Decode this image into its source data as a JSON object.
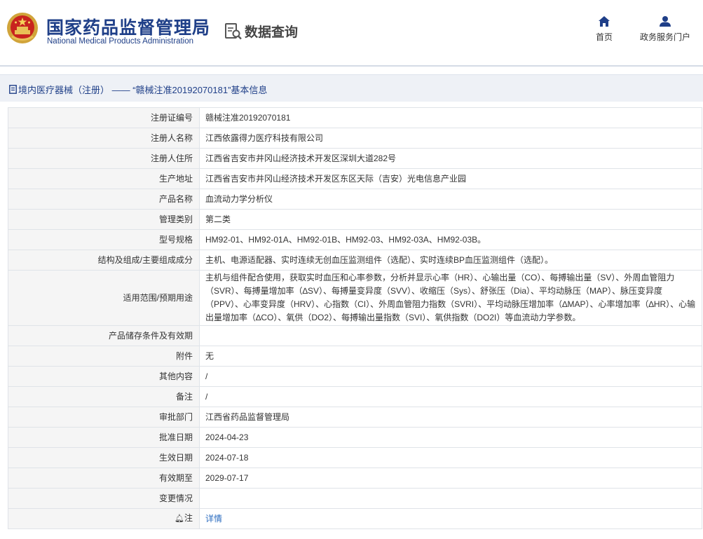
{
  "header": {
    "agency_name_cn": "国家药品监督管理局",
    "agency_name_en": "National Medical Products Administration",
    "module_title": "数据查询",
    "emblem_icon": "national-emblem-icon",
    "nav": [
      {
        "label": "首页",
        "icon": "home-icon"
      },
      {
        "label": "政务服务门户",
        "icon": "user-icon"
      }
    ]
  },
  "breadcrumb": {
    "icon": "document-icon",
    "text": "境内医疗器械（注册） —— “赣械注准20192070181”基本信息"
  },
  "fields": [
    {
      "label": "注册证编号",
      "value": "赣械注准20192070181"
    },
    {
      "label": "注册人名称",
      "value": "江西依露得力医疗科技有限公司"
    },
    {
      "label": "注册人住所",
      "value": "江西省吉安市井冈山经济技术开发区深圳大道282号"
    },
    {
      "label": "生产地址",
      "value": "江西省吉安市井冈山经济技术开发区东区天际（吉安）光电信息产业园"
    },
    {
      "label": "产品名称",
      "value": "血流动力学分析仪"
    },
    {
      "label": "管理类别",
      "value": "第二类"
    },
    {
      "label": "型号规格",
      "value": "HM92-01、HM92-01A、HM92-01B、HM92-03、HM92-03A、HM92-03B。"
    },
    {
      "label": "结构及组成/主要组成成分",
      "value": "主机、电源适配器、实时连续无创血压监测组件（选配）、实时连续BP血压监测组件（选配）。"
    },
    {
      "label": "适用范围/预期用途",
      "value": "主机与组件配合使用，获取实时血压和心率参数，分析并显示心率（HR）、心输出量（CO）、每搏输出量（SV）、外周血管阻力（SVR）、每搏量增加率（∆SV）、每搏量变异度（SVV）、收缩压（Sys）、舒张压（Dia）、平均动脉压（MAP）、脉压变异度（PPV）、心率变异度（HRV）、心指数（CI）、外周血管阻力指数（SVRI）、平均动脉压增加率（∆MAP）、心率增加率（∆HR）、心输出量增加率（∆CO）、氧供（DO2）、每搏输出量指数（SVI）、氧供指数（DO2I）等血流动力学参数。"
    },
    {
      "label": "产品储存条件及有效期",
      "value": ""
    },
    {
      "label": "附件",
      "value": "无"
    },
    {
      "label": "其他内容",
      "value": "/"
    },
    {
      "label": "备注",
      "value": "/"
    },
    {
      "label": "审批部门",
      "value": "江西省药品监督管理局"
    },
    {
      "label": "批准日期",
      "value": "2024-04-23"
    },
    {
      "label": "生效日期",
      "value": "2024-07-18"
    },
    {
      "label": "有效期至",
      "value": "2029-07-17"
    },
    {
      "label": "变更情况",
      "value": ""
    }
  ],
  "note_row": {
    "icon": "bell-icon",
    "label": "注",
    "link_text": "详情"
  },
  "colors": {
    "brand_blue": "#1f3f88",
    "label_bg": "#f5f5f5",
    "border": "#dfe3e8",
    "link": "#2a6bbf"
  }
}
